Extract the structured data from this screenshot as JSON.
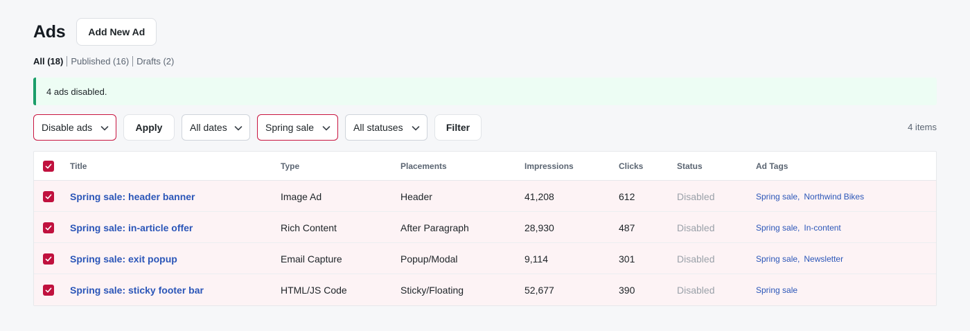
{
  "header": {
    "title": "Ads",
    "add_new_label": "Add New Ad"
  },
  "views": [
    {
      "label": "All (18)",
      "current": true
    },
    {
      "label": "Published (16)",
      "current": false
    },
    {
      "label": "Drafts (2)",
      "current": false
    }
  ],
  "notice": {
    "text": "4 ads disabled."
  },
  "toolbar": {
    "bulk_action": "Disable ads",
    "apply_label": "Apply",
    "dates_filter": "All dates",
    "tag_filter": "Spring sale",
    "status_filter": "All statuses",
    "filter_label": "Filter",
    "items_count": "4 items"
  },
  "table": {
    "columns": [
      "Title",
      "Type",
      "Placements",
      "Impressions",
      "Clicks",
      "Status",
      "Ad Tags"
    ],
    "rows": [
      {
        "title": "Spring sale: header banner",
        "type": "Image Ad",
        "placement": "Header",
        "impressions": "41,208",
        "clicks": "612",
        "status": "Disabled",
        "tags": [
          "Spring sale",
          "Northwind Bikes"
        ]
      },
      {
        "title": "Spring sale: in-article offer",
        "type": "Rich Content",
        "placement": "After Paragraph",
        "impressions": "28,930",
        "clicks": "487",
        "status": "Disabled",
        "tags": [
          "Spring sale",
          "In-content"
        ]
      },
      {
        "title": "Spring sale: exit popup",
        "type": "Email Capture",
        "placement": "Popup/Modal",
        "impressions": "9,114",
        "clicks": "301",
        "status": "Disabled",
        "tags": [
          "Spring sale",
          "Newsletter"
        ]
      },
      {
        "title": "Spring sale: sticky footer bar",
        "type": "HTML/JS Code",
        "placement": "Sticky/Floating",
        "impressions": "52,677",
        "clicks": "390",
        "status": "Disabled",
        "tags": [
          "Spring sale"
        ]
      }
    ]
  },
  "colors": {
    "accent": "#c0113e",
    "link": "#2b56b8",
    "notice_border": "#1c9e6a",
    "notice_bg": "#edfdf4",
    "row_selected_bg": "#fdf3f5"
  },
  "icons": {
    "dropdown": "chevron-down-icon",
    "checkbox": "checkmark-icon"
  }
}
